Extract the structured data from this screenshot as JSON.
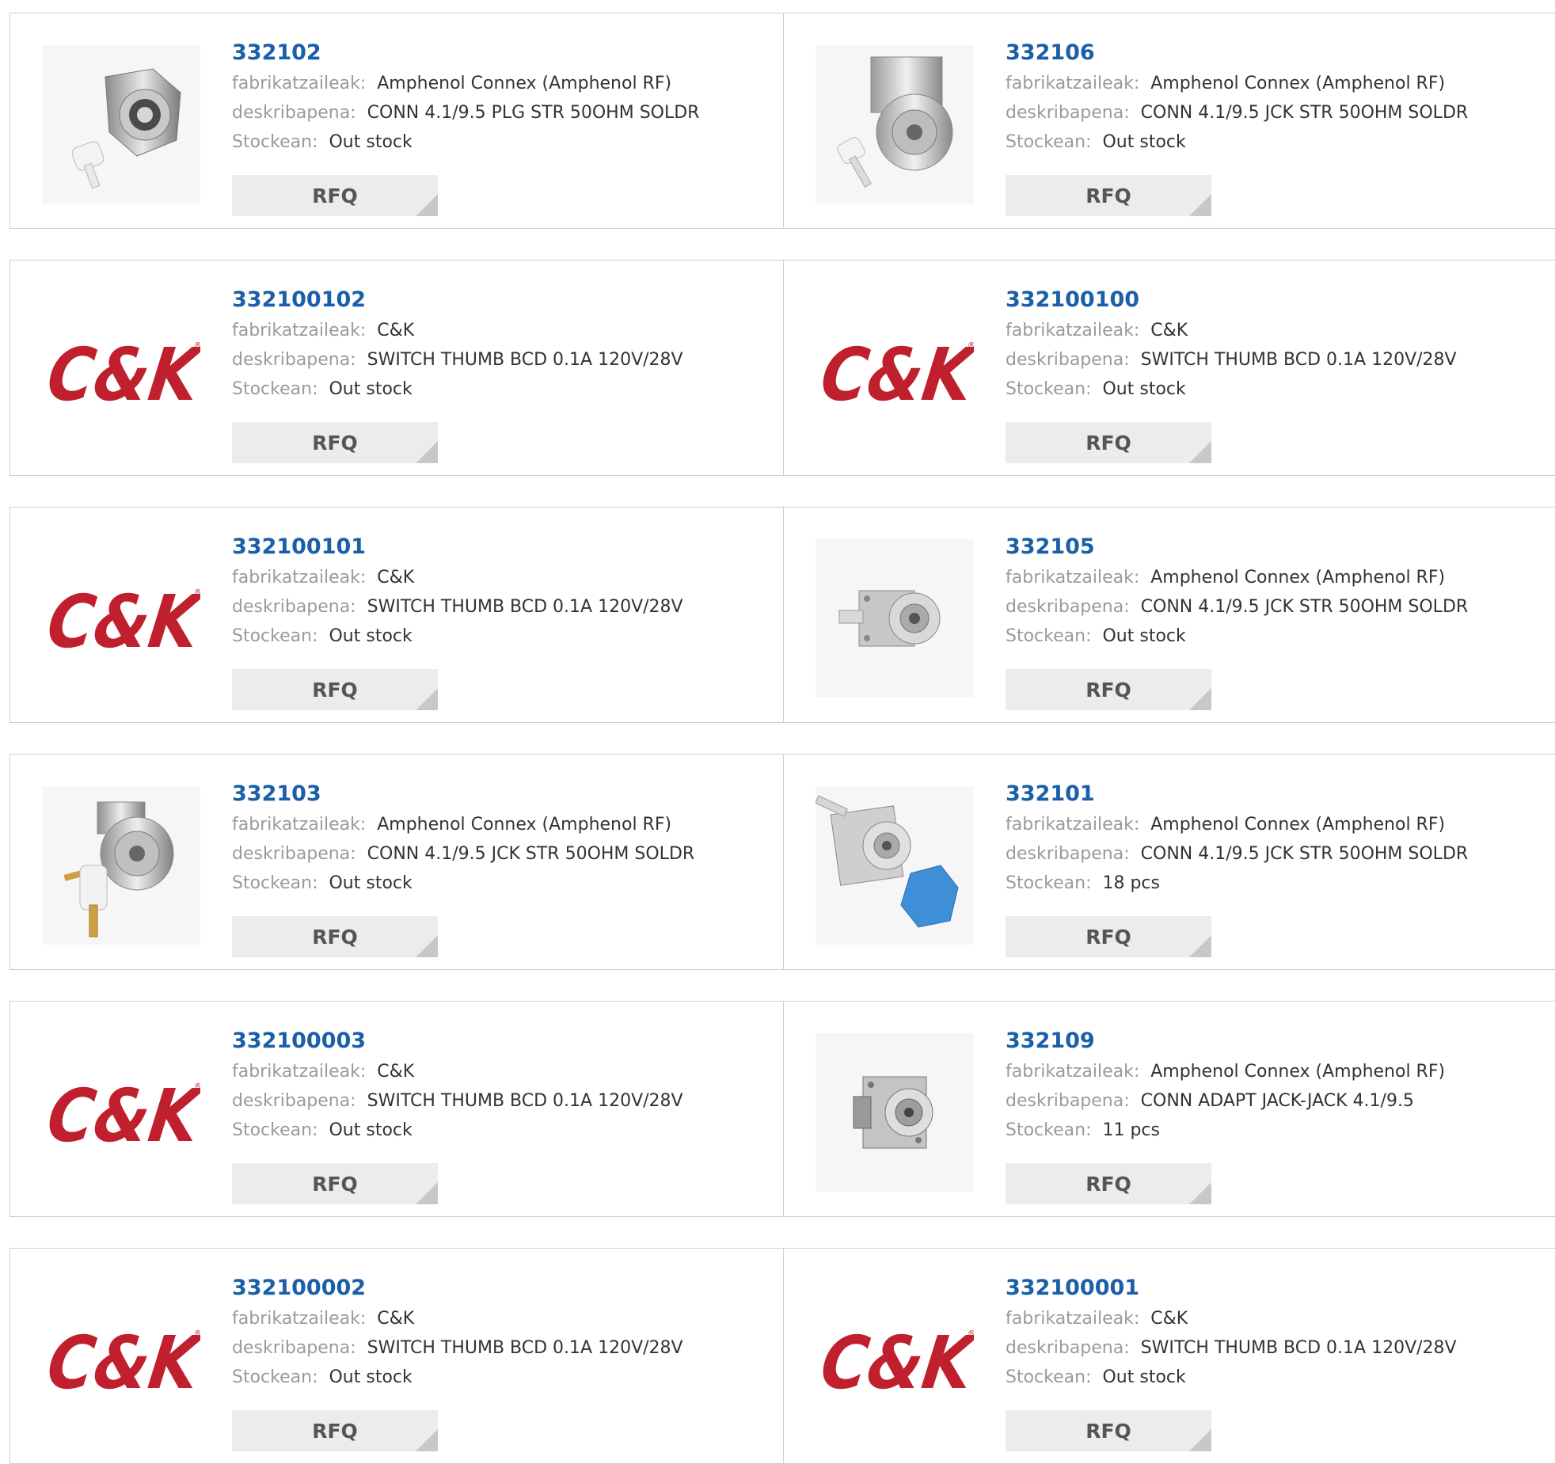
{
  "labels": {
    "manufacturer": "fabrikatzaileak:",
    "description": "deskribapena:",
    "stock": "Stockean:",
    "rfq": "RFQ",
    "brand_logo_text": "C&K"
  },
  "colors": {
    "part_number": "#1a5fa8",
    "brand_logo": "#c0202e",
    "label": "#9a9a9a"
  },
  "products": [
    {
      "part": "332102",
      "manufacturer": "Amphenol Connex (Amphenol RF)",
      "description": "CONN 4.1/9.5 PLG STR 50OHM SOLDR",
      "stock": "Out stock",
      "image": "connector-plug-photo"
    },
    {
      "part": "332106",
      "manufacturer": "Amphenol Connex (Amphenol RF)",
      "description": "CONN 4.1/9.5 JCK STR 50OHM SOLDR",
      "stock": "Out stock",
      "image": "connector-jack-photo"
    },
    {
      "part": "332100102",
      "manufacturer": "C&K",
      "description": "SWITCH THUMB BCD 0.1A 120V/28V",
      "stock": "Out stock",
      "image": "ck-logo"
    },
    {
      "part": "332100100",
      "manufacturer": "C&K",
      "description": "SWITCH THUMB BCD 0.1A 120V/28V",
      "stock": "Out stock",
      "image": "ck-logo"
    },
    {
      "part": "332100101",
      "manufacturer": "C&K",
      "description": "SWITCH THUMB BCD 0.1A 120V/28V",
      "stock": "Out stock",
      "image": "ck-logo"
    },
    {
      "part": "332105",
      "manufacturer": "Amphenol Connex (Amphenol RF)",
      "description": "CONN 4.1/9.5 JCK STR 50OHM SOLDR",
      "stock": "Out stock",
      "image": "panel-jack-photo"
    },
    {
      "part": "332103",
      "manufacturer": "Amphenol Connex (Amphenol RF)",
      "description": "CONN 4.1/9.5 JCK STR 50OHM SOLDR",
      "stock": "Out stock",
      "image": "connector-jack-pin-photo"
    },
    {
      "part": "332101",
      "manufacturer": "Amphenol Connex (Amphenol RF)",
      "description": "CONN 4.1/9.5 JCK STR 50OHM SOLDR",
      "stock": "18 pcs",
      "image": "panel-jack-cap-photo"
    },
    {
      "part": "332100003",
      "manufacturer": "C&K",
      "description": "SWITCH THUMB BCD 0.1A 120V/28V",
      "stock": "Out stock",
      "image": "ck-logo"
    },
    {
      "part": "332109",
      "manufacturer": "Amphenol Connex (Amphenol RF)",
      "description": "CONN ADAPT JACK-JACK 4.1/9.5",
      "stock": "11 pcs",
      "image": "adapter-photo"
    },
    {
      "part": "332100002",
      "manufacturer": "C&K",
      "description": "SWITCH THUMB BCD 0.1A 120V/28V",
      "stock": "Out stock",
      "image": "ck-logo"
    },
    {
      "part": "332100001",
      "manufacturer": "C&K",
      "description": "SWITCH THUMB BCD 0.1A 120V/28V",
      "stock": "Out stock",
      "image": "ck-logo"
    }
  ]
}
